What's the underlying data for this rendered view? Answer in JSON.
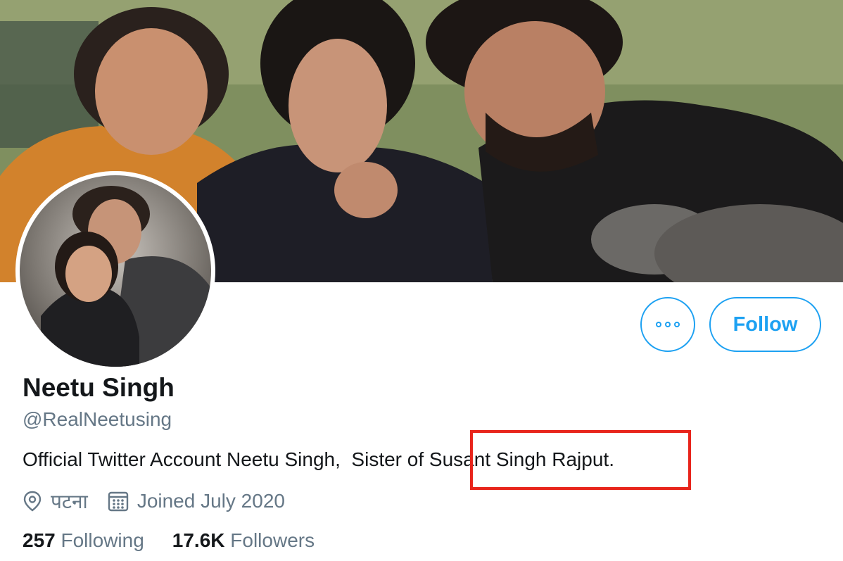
{
  "profile": {
    "name": "Neetu Singh",
    "handle": "@RealNeetusing",
    "bio_prefix": "Official Twitter Account Neetu Singh,  Sister of ",
    "bio_highlight": "Susant Singh Rajput.",
    "location": "पटना",
    "joined": "Joined July 2020"
  },
  "stats": {
    "following_count": "257",
    "following_label": "Following",
    "followers_count": "17.6K",
    "followers_label": "Followers"
  },
  "actions": {
    "follow_label": "Follow"
  },
  "colors": {
    "accent": "#1da1f2",
    "highlight_box": "#e8251c",
    "secondary_text": "#657786"
  },
  "icons": [
    "more-icon",
    "location-pin-icon",
    "calendar-icon"
  ]
}
